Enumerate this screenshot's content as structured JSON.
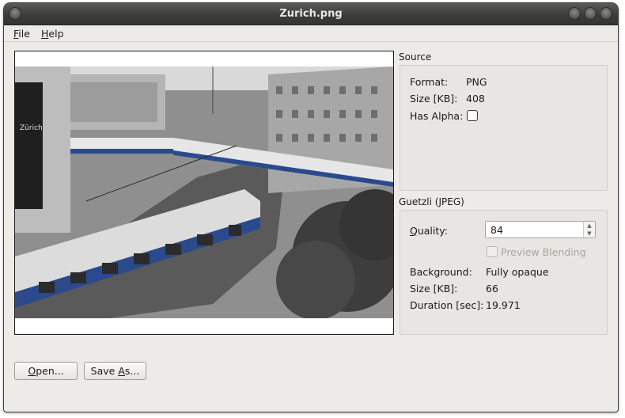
{
  "window": {
    "title": "Zurich.png"
  },
  "menu": [
    {
      "label": "File",
      "mnemonic": "F",
      "rest": "ile"
    },
    {
      "label": "Help",
      "mnemonic": "H",
      "rest": "elp"
    }
  ],
  "source": {
    "title": "Source",
    "format_label": "Format:",
    "format_value": "PNG",
    "size_label": "Size [KB]:",
    "size_value": "408",
    "alpha_label": "Has Alpha:",
    "alpha_checked": false
  },
  "guetzli": {
    "title": "Guetzli (JPEG)",
    "quality_label": "Quality:",
    "quality_value": "84",
    "preview_blending_label": "Preview Blending",
    "preview_blending_checked": false,
    "background_label": "Background:",
    "background_value": "Fully opaque",
    "size_label": "Size [KB]:",
    "size_value": "66",
    "duration_label": "Duration [sec]:",
    "duration_value": "19.971"
  },
  "buttons": {
    "open": {
      "label": "Open...",
      "mnemonic": "O",
      "rest": "pen..."
    },
    "save_as": {
      "label": "Save As...",
      "before": "Save ",
      "mnemonic": "A",
      "rest": "s..."
    }
  },
  "image": {
    "description": "Black-and-white photo of trams at a Zurich street intersection with blue accents"
  },
  "colors": {
    "titlebar": "#3c3c3a",
    "window_bg": "#edebe7",
    "tram_blue": "#2a4a8c"
  }
}
